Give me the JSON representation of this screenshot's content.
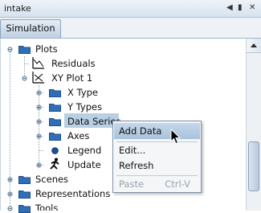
{
  "window": {
    "title": "intake",
    "buttons": [
      "◀",
      "▮",
      "✕"
    ]
  },
  "tabs": [
    {
      "label": "Simulation"
    }
  ],
  "tree": {
    "plots": "Plots",
    "residuals": "Residuals",
    "xyplot": "XY Plot 1",
    "xtype": "X Type",
    "ytypes": "Y Types",
    "dataseries": "Data Series",
    "axes": "Axes",
    "legend": "Legend",
    "update": "Update",
    "scenes": "Scenes",
    "representations": "Representations",
    "tools": "Tools"
  },
  "context_menu": {
    "add_data": "Add Data",
    "edit": "Edit...",
    "refresh": "Refresh",
    "paste": "Paste",
    "paste_shortcut": "Ctrl-V"
  },
  "colors": {
    "folder": "#2f6fb8",
    "selection": "#b8cfe4",
    "menu_active": "#a8c2dc"
  }
}
